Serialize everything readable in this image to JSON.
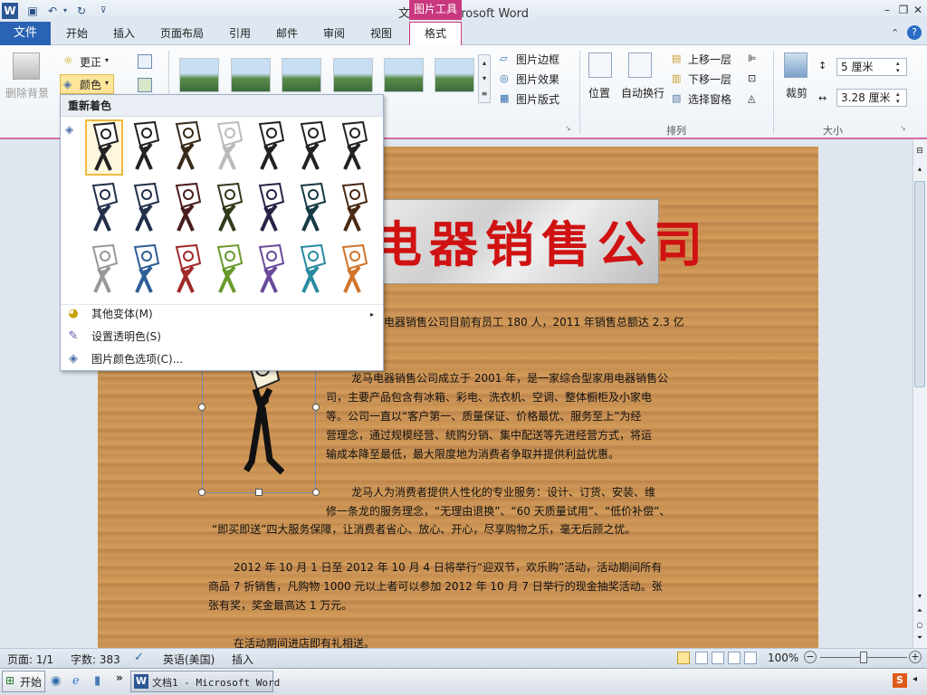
{
  "window": {
    "title": "文档1  -  Microsoft Word",
    "context_tab": "图片工具"
  },
  "tabs": [
    "文件",
    "开始",
    "插入",
    "页面布局",
    "引用",
    "邮件",
    "审阅",
    "视图",
    "格式"
  ],
  "ribbon": {
    "adjust": {
      "remove_bg": "删除背景",
      "corrections": "更正",
      "color": "颜色"
    },
    "picture_styles": {
      "border": "图片边框",
      "effects": "图片效果",
      "layout": "图片版式"
    },
    "arrange": {
      "position": "位置",
      "wrap": "自动换行",
      "bring_forward": "上移一层",
      "send_backward": "下移一层",
      "selection_pane": "选择窗格",
      "group_label": "排列"
    },
    "size": {
      "crop": "裁剪",
      "width": "5 厘米",
      "height": "3.28 厘米",
      "group_label": "大小"
    }
  },
  "color_menu": {
    "header": "重新着色",
    "variants": [
      {
        "color": "#222222",
        "bg": "#ffffff"
      },
      {
        "color": "#222222",
        "bg": "#ffffff"
      },
      {
        "color": "#3a2a1a",
        "bg": "#ffffff"
      },
      {
        "color": "#bbbbbb",
        "bg": "#ffffff"
      },
      {
        "color": "#222222",
        "bg": "#ffffff"
      },
      {
        "color": "#222222",
        "bg": "#ffffff"
      },
      {
        "color": "#222222",
        "bg": "#ffffff"
      },
      {
        "color": "#22304a",
        "bg": "#ffffff"
      },
      {
        "color": "#22304a",
        "bg": "#ffffff"
      },
      {
        "color": "#4a1d1d",
        "bg": "#ffffff"
      },
      {
        "color": "#2f3a1a",
        "bg": "#ffffff"
      },
      {
        "color": "#2a2246",
        "bg": "#ffffff"
      },
      {
        "color": "#163a44",
        "bg": "#ffffff"
      },
      {
        "color": "#4a2a14",
        "bg": "#ffffff"
      },
      {
        "color": "#999999",
        "bg": "#ffffff"
      },
      {
        "color": "#2e5e96",
        "bg": "#ffffff"
      },
      {
        "color": "#a02828",
        "bg": "#ffffff"
      },
      {
        "color": "#6a9a2c",
        "bg": "#ffffff"
      },
      {
        "color": "#6a4a9a",
        "bg": "#ffffff"
      },
      {
        "color": "#2a8aa0",
        "bg": "#ffffff"
      },
      {
        "color": "#d0742a",
        "bg": "#ffffff"
      }
    ],
    "more_variants": "其他变体(M)",
    "set_transparent": "设置透明色(S)",
    "color_options": "图片颜色选项(C)..."
  },
  "document": {
    "banner": "电器销售公司",
    "paragraphs": [
      "电器销售公司目前有员工 180 人，2011 年销售总额达 2.3 亿",
      "龙马电器销售公司成立于 2001 年，是一家综合型家用电器销售公",
      "司，主要产品包含有冰箱、彩电、洗衣机、空调、整体橱柜及小家电",
      "等。公司一直以“客户第一、质量保证、价格最优、服务至上”为经",
      "营理念，通过规模经营、统购分销、集中配送等先进经营方式，将运",
      "输成本降至最低，最大限度地为消费者争取并提供利益优惠。",
      "龙马人为消费者提供人性化的专业服务：设计、订货、安装、维",
      "修一条龙的服务理念，“无理由退换”、“60 天质量试用”、“低价补偿”、",
      "“即买即送”四大服务保障，让消费者省心、放心、开心，尽享购物之乐，毫无后顾之忧。",
      "2012 年 10 月 1 日至 2012 年 10 月 4 日将举行“迎双节，欢乐购”活动，活动期间所有",
      "商品 7 折销售，凡购物 1000 元以上者可以参加 2012 年 10 月 7 日举行的现金抽奖活动。张",
      "张有奖，奖金最高达 1 万元。",
      "在活动期间进店即有礼相送。"
    ]
  },
  "status": {
    "page": "页面: 1/1",
    "words": "字数: 383",
    "language": "英语(美国)",
    "mode": "插入",
    "zoom": "100%"
  },
  "taskbar": {
    "start": "开始",
    "window": "文档1 - Microsoft Word"
  }
}
